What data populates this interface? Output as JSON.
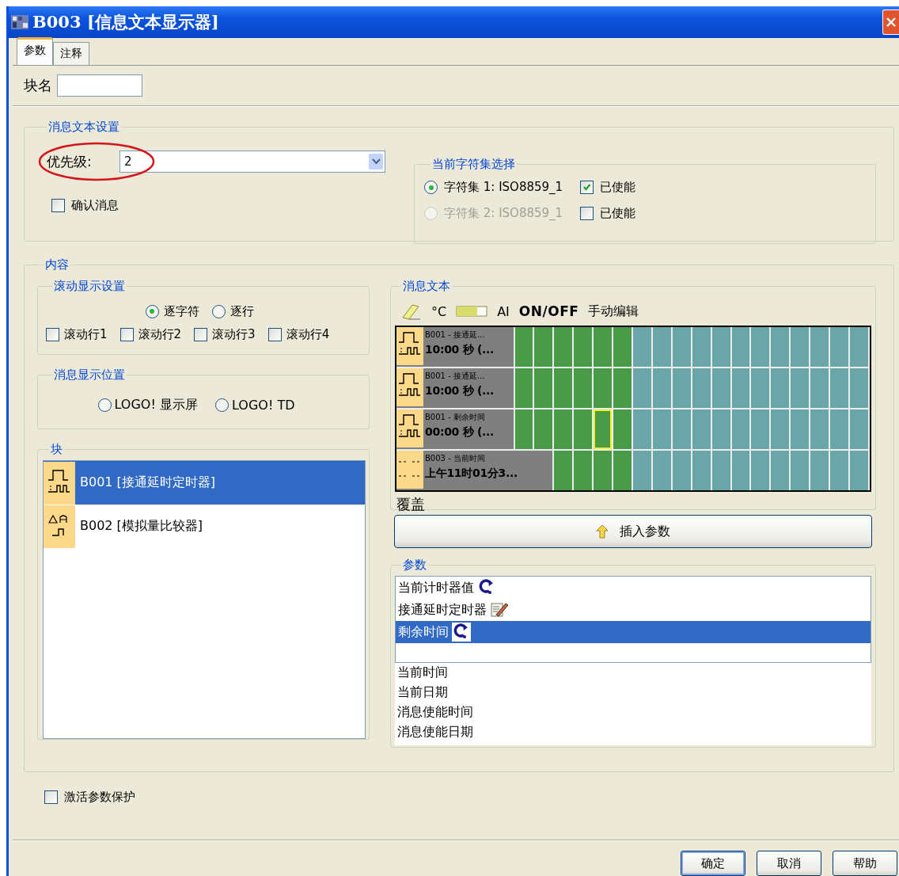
{
  "window": {
    "title": "B003 [信息文本显示器]"
  },
  "tabs": [
    {
      "label": "参数",
      "selected": true
    },
    {
      "label": "注释",
      "selected": false
    }
  ],
  "block_name": {
    "label": "块名"
  },
  "message_settings": {
    "legend": "消息文本设置",
    "priority": {
      "label": "优先级:",
      "value": "2"
    },
    "confirm": {
      "label": "确认消息",
      "checked": false
    }
  },
  "charset": {
    "legend": "当前字符集选择",
    "options": [
      {
        "label": "字符集 1: ISO8859_1",
        "selected": true,
        "disabled": false,
        "enabled_label": "已使能",
        "enabled_checked": true
      },
      {
        "label": "字符集 2: ISO8859_1",
        "selected": false,
        "disabled": true,
        "enabled_label": "已使能",
        "enabled_checked": false
      }
    ]
  },
  "content": {
    "legend": "内容",
    "scroll": {
      "legend": "滚动显示设置",
      "modes": [
        {
          "label": "逐字符",
          "selected": true
        },
        {
          "label": "逐行",
          "selected": false
        }
      ],
      "lines": [
        {
          "label": "滚动行1",
          "checked": false
        },
        {
          "label": "滚动行2",
          "checked": false
        },
        {
          "label": "滚动行3",
          "checked": false
        },
        {
          "label": "滚动行4",
          "checked": false
        }
      ]
    },
    "position": {
      "legend": "消息显示位置",
      "options": [
        {
          "label": "LOGO! 显示屏",
          "selected": false
        },
        {
          "label": "LOGO! TD",
          "selected": false
        }
      ]
    },
    "blocks": {
      "legend": "块",
      "items": [
        {
          "label": "B001 [接通延时定时器]",
          "kind": "timer",
          "selected": true
        },
        {
          "label": "B002 [模拟量比较器]",
          "kind": "comparator",
          "selected": false
        }
      ]
    },
    "message_text": {
      "legend": "消息文本",
      "toolbar": [
        {
          "kind": "eraser"
        },
        {
          "kind": "text",
          "label": "°C"
        },
        {
          "kind": "bar"
        },
        {
          "kind": "text",
          "label": "AI"
        },
        {
          "kind": "bold",
          "label": "ON/OFF"
        },
        {
          "kind": "text",
          "label": "手动编辑"
        }
      ],
      "lines": [
        {
          "kind": "timer",
          "title": "B001 - 接通延...",
          "value": "10:00 秒 (...",
          "cursor": false
        },
        {
          "kind": "timer",
          "title": "B001 - 接通延...",
          "value": "10:00 秒 (...",
          "cursor": false
        },
        {
          "kind": "timer",
          "title": "B001 - 剩余时间",
          "value": "00:00 秒 (...",
          "cursor": true
        },
        {
          "kind": "clock",
          "title": "B003 - 当前时间",
          "value": "上午11时01分3...",
          "cursor": false
        }
      ],
      "mode": "覆盖"
    },
    "insert_button": {
      "label": "插入参数"
    },
    "params": {
      "legend": "参数",
      "items": [
        {
          "label": "当前计时器值",
          "kind": "refresh",
          "selected": false
        },
        {
          "label": "接通延时定时器",
          "kind": "edit",
          "selected": false
        },
        {
          "label": "剩余时间",
          "kind": "refresh",
          "selected": true
        }
      ],
      "extra_items": [
        {
          "label": "当前时间",
          "selected": false
        },
        {
          "label": "当前日期",
          "selected": false
        },
        {
          "label": "消息使能时间",
          "selected": false
        },
        {
          "label": "消息使能日期",
          "selected": false
        }
      ]
    }
  },
  "protect": {
    "label": "激活参数保护",
    "checked": false
  },
  "buttons": [
    {
      "label": "确定",
      "default": true
    },
    {
      "label": "取消",
      "default": false
    },
    {
      "label": "帮助",
      "default": false
    }
  ]
}
